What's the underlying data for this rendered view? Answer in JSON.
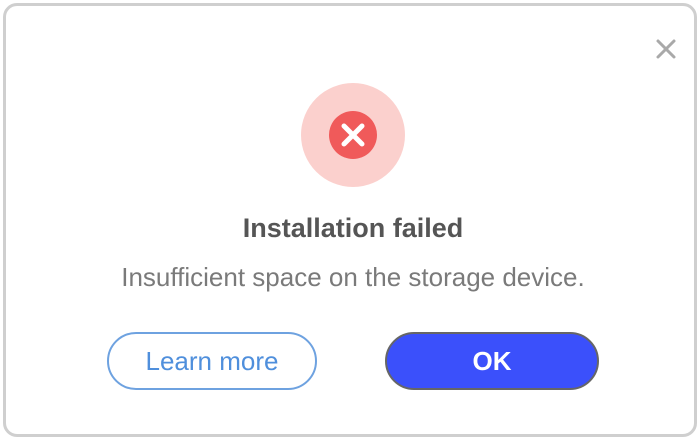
{
  "dialog": {
    "title": "Installation failed",
    "message": "Insufficient space on the storage device.",
    "icons": {
      "close": "close-icon",
      "status": "error-icon"
    },
    "buttons": {
      "learn_more_label": "Learn more",
      "ok_label": "OK"
    }
  },
  "colors": {
    "error_red": "#f05a5a",
    "error_bg": "#fbd0cd",
    "primary_blue": "#3b50fb",
    "link_blue": "#4f8fdc"
  }
}
